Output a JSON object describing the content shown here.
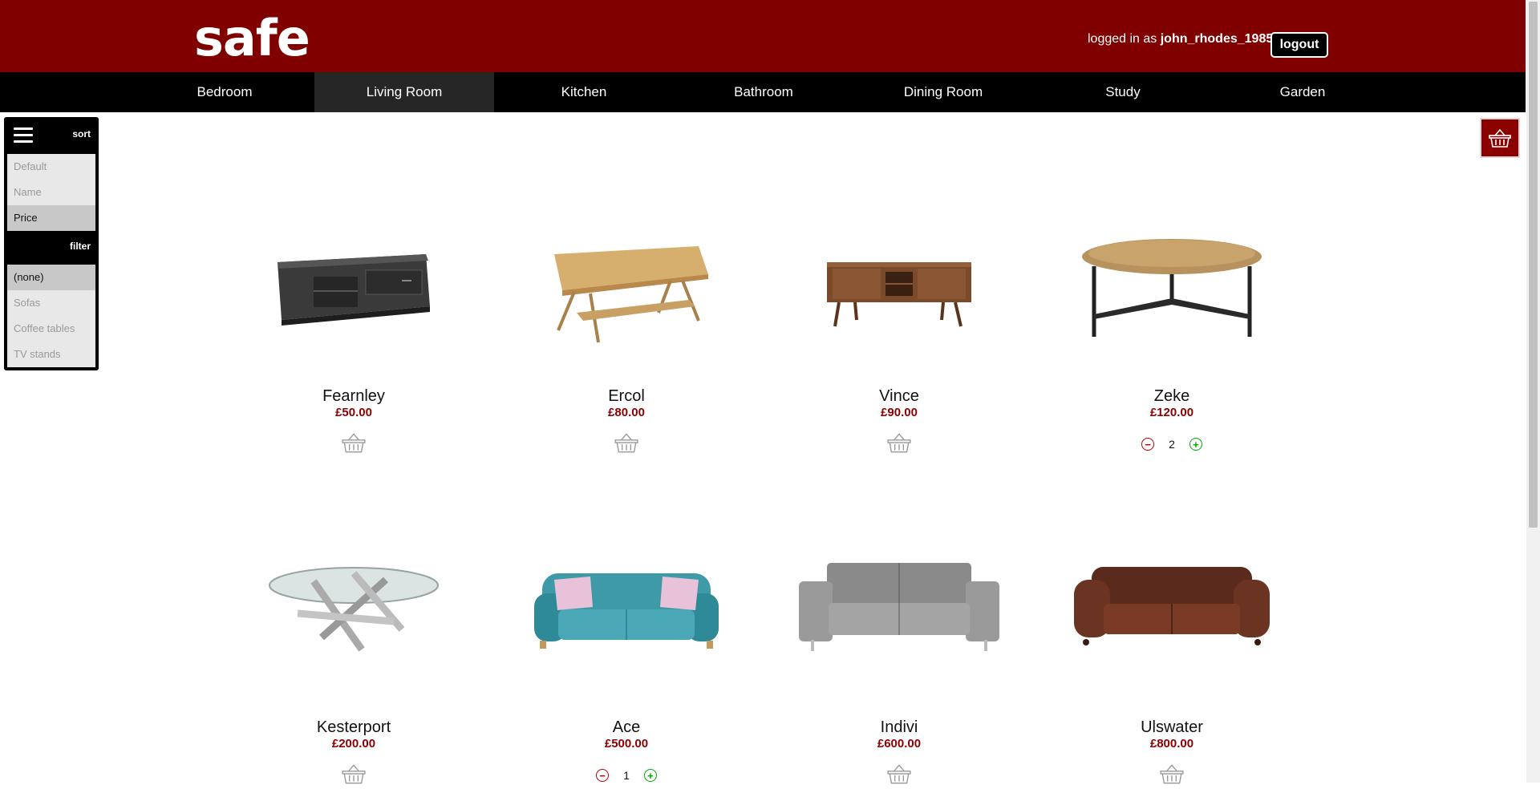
{
  "header": {
    "logo": "safe",
    "logged_in_prefix": "logged in as ",
    "username": "john_rhodes_1985",
    "logout_label": "logout"
  },
  "nav": [
    {
      "label": "Bedroom"
    },
    {
      "label": "Living Room",
      "active": true
    },
    {
      "label": "Kitchen"
    },
    {
      "label": "Bathroom"
    },
    {
      "label": "Dining Room"
    },
    {
      "label": "Study"
    },
    {
      "label": "Garden"
    }
  ],
  "sidebar": {
    "sort_title": "sort",
    "sort_options": [
      "Default",
      "Name",
      "Price"
    ],
    "sort_selected": "Price",
    "filter_title": "filter",
    "filter_options": [
      "(none)",
      "Sofas",
      "Coffee tables",
      "TV stands"
    ],
    "filter_selected": "(none)"
  },
  "products": [
    {
      "name": "Fearnley",
      "price": "£50.00",
      "image": "tv-stand-dark"
    },
    {
      "name": "Ercol",
      "price": "£80.00",
      "image": "coffee-table-wood"
    },
    {
      "name": "Vince",
      "price": "£90.00",
      "image": "tv-stand-walnut"
    },
    {
      "name": "Zeke",
      "price": "£120.00",
      "image": "round-coffee-table",
      "quantity": "2"
    },
    {
      "name": "Kesterport",
      "price": "£200.00",
      "image": "glass-coffee-table"
    },
    {
      "name": "Ace",
      "price": "£500.00",
      "image": "teal-sofa",
      "quantity": "1"
    },
    {
      "name": "Indivi",
      "price": "£600.00",
      "image": "grey-sofa"
    },
    {
      "name": "Ulswater",
      "price": "£800.00",
      "image": "leather-chesterfield"
    }
  ],
  "colors": {
    "brand": "#800000",
    "nav": "#000000",
    "price": "#8b0000"
  }
}
